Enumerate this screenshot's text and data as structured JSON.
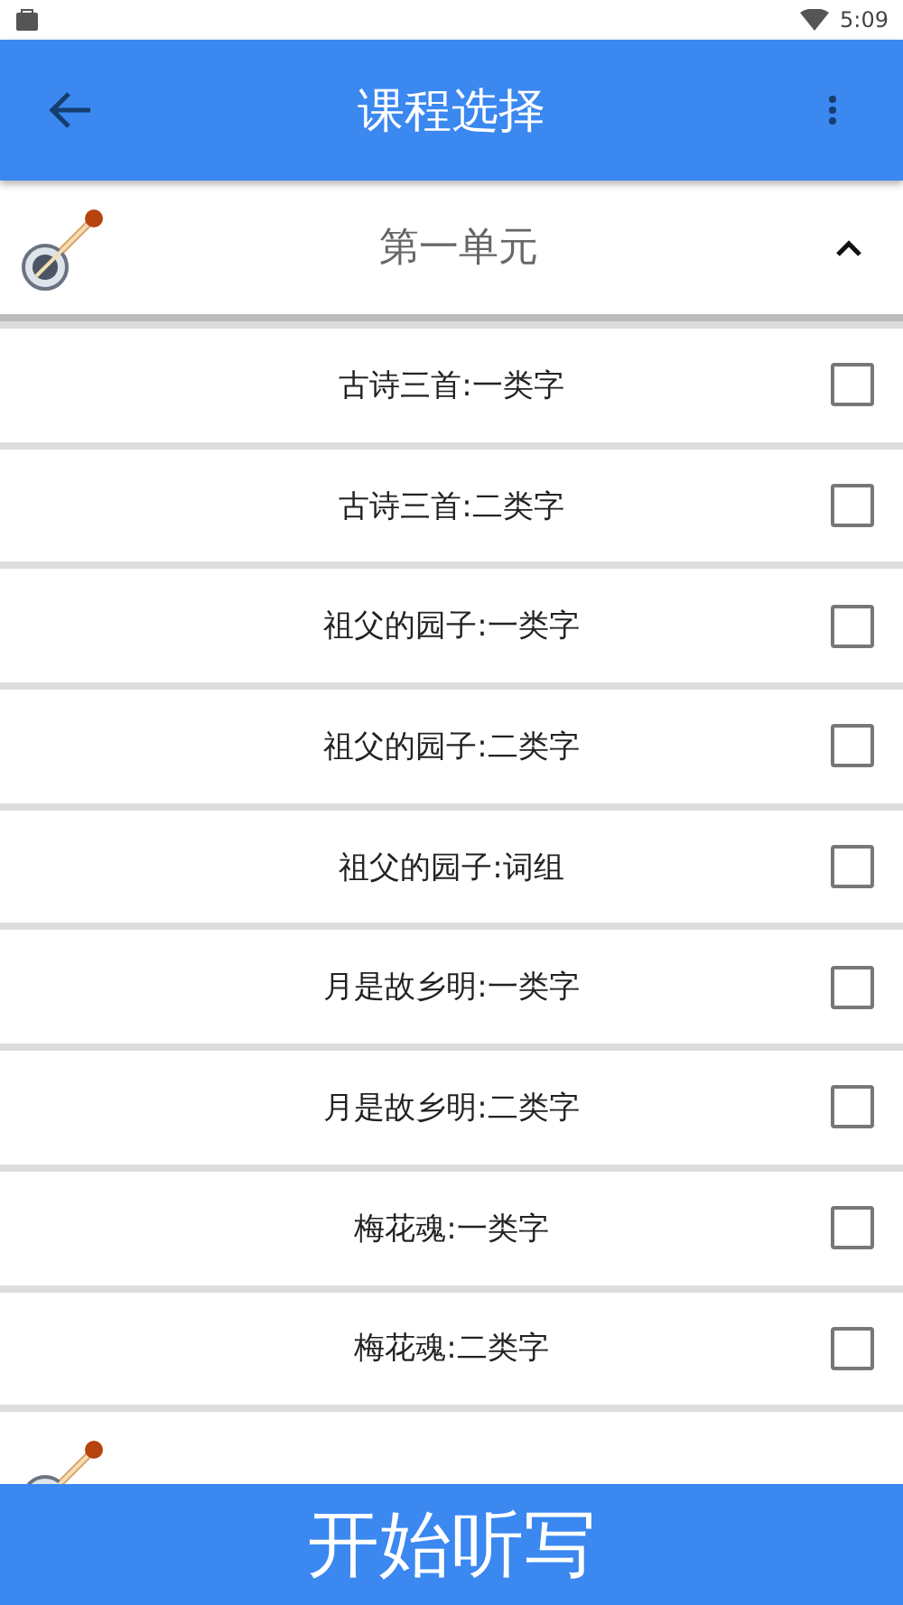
{
  "status_bar": {
    "time": "5:09"
  },
  "app_bar": {
    "title": "课程选择"
  },
  "units": [
    {
      "kind": "unit",
      "title": "第一单元",
      "expanded": true,
      "lessons": [
        {
          "label": "古诗三首:一类字",
          "checked": false
        },
        {
          "label": "古诗三首:二类字",
          "checked": false
        },
        {
          "label": "祖父的园子:一类字",
          "checked": false
        },
        {
          "label": "祖父的园子:二类字",
          "checked": false
        },
        {
          "label": "祖父的园子:词组",
          "checked": false
        },
        {
          "label": "月是故乡明:一类字",
          "checked": false
        },
        {
          "label": "月是故乡明:二类字",
          "checked": false
        },
        {
          "label": "梅花魂:一类字",
          "checked": false
        },
        {
          "label": "梅花魂:二类字",
          "checked": false
        }
      ]
    },
    {
      "kind": "unit"
    }
  ],
  "start_button": {
    "label": "开始听写"
  }
}
